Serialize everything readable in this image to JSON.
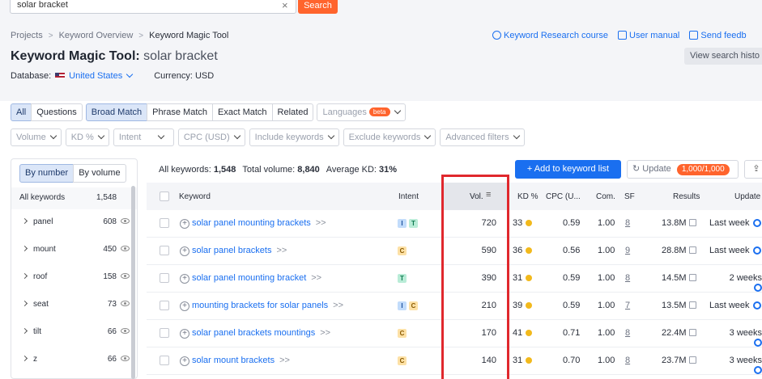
{
  "search": {
    "value": "solar bracket",
    "button": "Search"
  },
  "breadcrumb": [
    "Projects",
    "Keyword Overview",
    "Keyword Magic Tool"
  ],
  "title": {
    "tool": "Keyword Magic Tool:",
    "keyword": "solar bracket"
  },
  "database": {
    "label": "Database:",
    "value": "United States",
    "currency": "Currency: USD"
  },
  "help": {
    "course": "Keyword Research course",
    "manual": "User manual",
    "feedback": "Send feedb"
  },
  "view_history": "View search histo",
  "match_tabs": {
    "all": "All",
    "questions": "Questions",
    "broad": "Broad Match",
    "phrase": "Phrase Match",
    "exact": "Exact Match",
    "related": "Related",
    "languages": "Languages",
    "beta": "beta"
  },
  "filters": [
    "Volume",
    "KD %",
    "Intent",
    "CPC (USD)",
    "Include keywords",
    "Exclude keywords",
    "Advanced filters"
  ],
  "left_panel": {
    "by_number": "By number",
    "by_volume": "By volume",
    "head_label": "All keywords",
    "head_count": "1,548",
    "groups": [
      {
        "word": "panel",
        "count": "608"
      },
      {
        "word": "mount",
        "count": "450"
      },
      {
        "word": "roof",
        "count": "158"
      },
      {
        "word": "seat",
        "count": "73"
      },
      {
        "word": "tilt",
        "count": "66"
      },
      {
        "word": "z",
        "count": "66"
      }
    ]
  },
  "summary": {
    "all_label": "All keywords:",
    "all_value": "1,548",
    "vol_label": "Total volume:",
    "vol_value": "8,840",
    "kd_label": "Average KD:",
    "kd_value": "31%"
  },
  "actions": {
    "add": "+ Add to keyword list",
    "update": "Update",
    "update_count": "1,000/1,000"
  },
  "columns": [
    "Keyword",
    "Intent",
    "Vol.",
    "KD %",
    "CPC (U...",
    "Com.",
    "SF",
    "Results",
    "Update"
  ],
  "rows": [
    {
      "keyword": "solar panel mounting brackets",
      "intent": [
        "I",
        "T"
      ],
      "vol": "720",
      "kd": "33",
      "cpc": "0.59",
      "com": "1.00",
      "sf": "8",
      "results": "13.8M",
      "updated": "Last week"
    },
    {
      "keyword": "solar panel brackets",
      "intent": [
        "C"
      ],
      "vol": "590",
      "kd": "36",
      "cpc": "0.56",
      "com": "1.00",
      "sf": "9",
      "results": "28.8M",
      "updated": "Last week"
    },
    {
      "keyword": "solar panel mounting bracket",
      "intent": [
        "T"
      ],
      "vol": "390",
      "kd": "31",
      "cpc": "0.59",
      "com": "1.00",
      "sf": "8",
      "results": "14.5M",
      "updated": "2 weeks"
    },
    {
      "keyword": "mounting brackets for solar panels",
      "intent": [
        "I",
        "C"
      ],
      "vol": "210",
      "kd": "39",
      "cpc": "0.59",
      "com": "1.00",
      "sf": "7",
      "results": "13.5M",
      "updated": "Last week"
    },
    {
      "keyword": "solar panel brackets mountings",
      "intent": [
        "C"
      ],
      "vol": "170",
      "kd": "41",
      "cpc": "0.71",
      "com": "1.00",
      "sf": "8",
      "results": "22.4M",
      "updated": "3 weeks"
    },
    {
      "keyword": "solar mount brackets",
      "intent": [
        "C"
      ],
      "vol": "140",
      "kd": "31",
      "cpc": "0.70",
      "com": "1.00",
      "sf": "8",
      "results": "23.7M",
      "updated": "3 weeks"
    }
  ],
  "colors": {
    "accent": "#1a6ff0",
    "brand": "#ff642d",
    "highlight": "#e0282d"
  }
}
